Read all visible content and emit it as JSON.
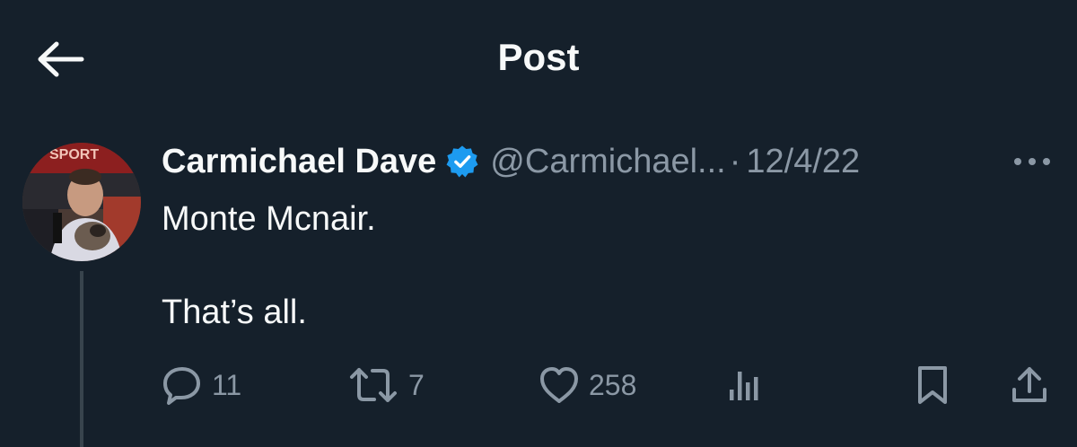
{
  "header": {
    "title": "Post",
    "back_icon": "arrow-left-icon"
  },
  "post": {
    "author_name": "Carmichael Dave",
    "verified_icon": "verified-badge-icon",
    "handle": "@Carmichael...",
    "separator": "·",
    "date": "12/4/22",
    "more_icon": "more-horizontal-icon",
    "text_line_1": "Monte Mcnair.",
    "text_line_2": "That’s all."
  },
  "actions": {
    "replies": "11",
    "reposts": "7",
    "likes": "258"
  },
  "colors": {
    "background": "#15202b",
    "text": "#f7f9f9",
    "secondary": "#8b98a5",
    "verified": "#1d9bf0",
    "thread_line": "#38444d"
  }
}
